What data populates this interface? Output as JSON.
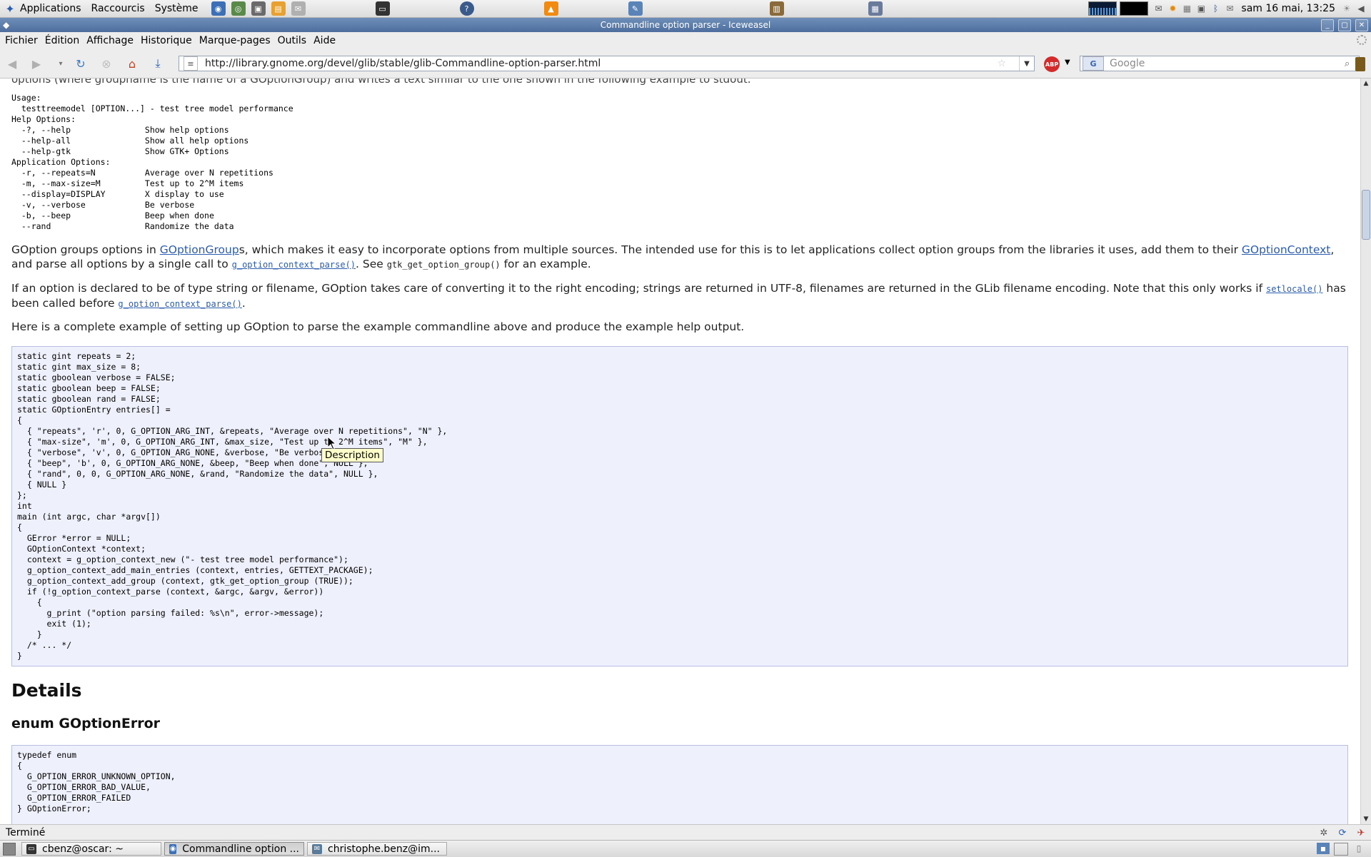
{
  "top_panel": {
    "menus": [
      "Applications",
      "Raccourcis",
      "Système"
    ],
    "launchers": [
      "globe-icon",
      "network-icon",
      "computer-icon",
      "notes-icon",
      "mail-icon"
    ],
    "apps": [
      "terminal-icon",
      "help-icon",
      "vlc-icon",
      "drawing-icon",
      "clipboard-icon",
      "printer-icon"
    ],
    "clock": "sam 16 mai, 13:25"
  },
  "window": {
    "title": "Commandline option parser - Iceweasel"
  },
  "menubar": {
    "items": [
      "Fichier",
      "Édition",
      "Affichage",
      "Historique",
      "Marque-pages",
      "Outils",
      "Aide"
    ]
  },
  "navbar": {
    "url": "http://library.gnome.org/devel/glib/stable/glib-Commandline-option-parser.html",
    "search_placeholder": "Google",
    "abp_label": "ABP",
    "engine_label": "G"
  },
  "page": {
    "cut_line_text": "options (where groupname is the name of a GOptionGroup) and writes a text similar to the one shown in the following example to stdout.",
    "usage_block": "Usage:\n  testtreemodel [OPTION...] - test tree model performance\nHelp Options:\n  -?, --help               Show help options\n  --help-all               Show all help options\n  --help-gtk               Show GTK+ Options\nApplication Options:\n  -r, --repeats=N          Average over N repetitions\n  -m, --max-size=M         Test up to 2^M items\n  --display=DISPLAY        X display to use\n  -v, --verbose            Be verbose\n  -b, --beep               Beep when done\n  --rand                   Randomize the data",
    "para1": {
      "t1": "GOption groups options in ",
      "l1": "GOptionGroup",
      "t2": "s, which makes it easy to incorporate options from multiple sources. The intended use for this is to let applications collect option groups from the libraries it uses, add them to their ",
      "l2": "GOptionContext",
      "t3": ", and parse all options by a single call to ",
      "c1": "g_option_context_parse()",
      "t4": ". See ",
      "c2": "gtk_get_option_group()",
      "t5": " for an example."
    },
    "para2": {
      "t1": "If an option is declared to be of type string or filename, GOption takes care of converting it to the right encoding; strings are returned in UTF-8, filenames are returned in the GLib filename encoding. Note that this only works if ",
      "c1": "setlocale()",
      "t2": " has been called before ",
      "c2": "g_option_context_parse()",
      "t3": "."
    },
    "para3": "Here is a complete example of setting up GOption to parse the example commandline above and produce the example help output.",
    "code_example": "static gint repeats = 2;\nstatic gint max_size = 8;\nstatic gboolean verbose = FALSE;\nstatic gboolean beep = FALSE;\nstatic gboolean rand = FALSE;\nstatic GOptionEntry entries[] =\n{\n  { \"repeats\", 'r', 0, G_OPTION_ARG_INT, &repeats, \"Average over N repetitions\", \"N\" },\n  { \"max-size\", 'm', 0, G_OPTION_ARG_INT, &max_size, \"Test up to 2^M items\", \"M\" },\n  { \"verbose\", 'v', 0, G_OPTION_ARG_NONE, &verbose, \"Be verbose\", NULL },\n  { \"beep\", 'b', 0, G_OPTION_ARG_NONE, &beep, \"Beep when done\", NULL },\n  { \"rand\", 0, 0, G_OPTION_ARG_NONE, &rand, \"Randomize the data\", NULL },\n  { NULL }\n};\nint\nmain (int argc, char *argv[])\n{\n  GError *error = NULL;\n  GOptionContext *context;\n  context = g_option_context_new (\"- test tree model performance\");\n  g_option_context_add_main_entries (context, entries, GETTEXT_PACKAGE);\n  g_option_context_add_group (context, gtk_get_option_group (TRUE));\n  if (!g_option_context_parse (context, &argc, &argv, &error))\n    {\n      g_print (\"option parsing failed: %s\\n\", error->message);\n      exit (1);\n    }\n  /* ... */\n}",
    "details_heading": "Details",
    "enum_heading": "enum GOptionError",
    "code_enum": "typedef enum\n{\n  G_OPTION_ERROR_UNKNOWN_OPTION,\n  G_OPTION_ERROR_BAD_VALUE,\n  G_OPTION_ERROR_FAILED\n} GOptionError;",
    "tooltip": "Description"
  },
  "statusbar": {
    "text": "Terminé"
  },
  "taskbar": {
    "tasks": [
      {
        "label": "cbenz@oscar: ~",
        "icon": "terminal-icon"
      },
      {
        "label": "Commandline option ...",
        "icon": "browser-icon"
      },
      {
        "label": "christophe.benz@im...",
        "icon": "mail-icon"
      }
    ]
  }
}
